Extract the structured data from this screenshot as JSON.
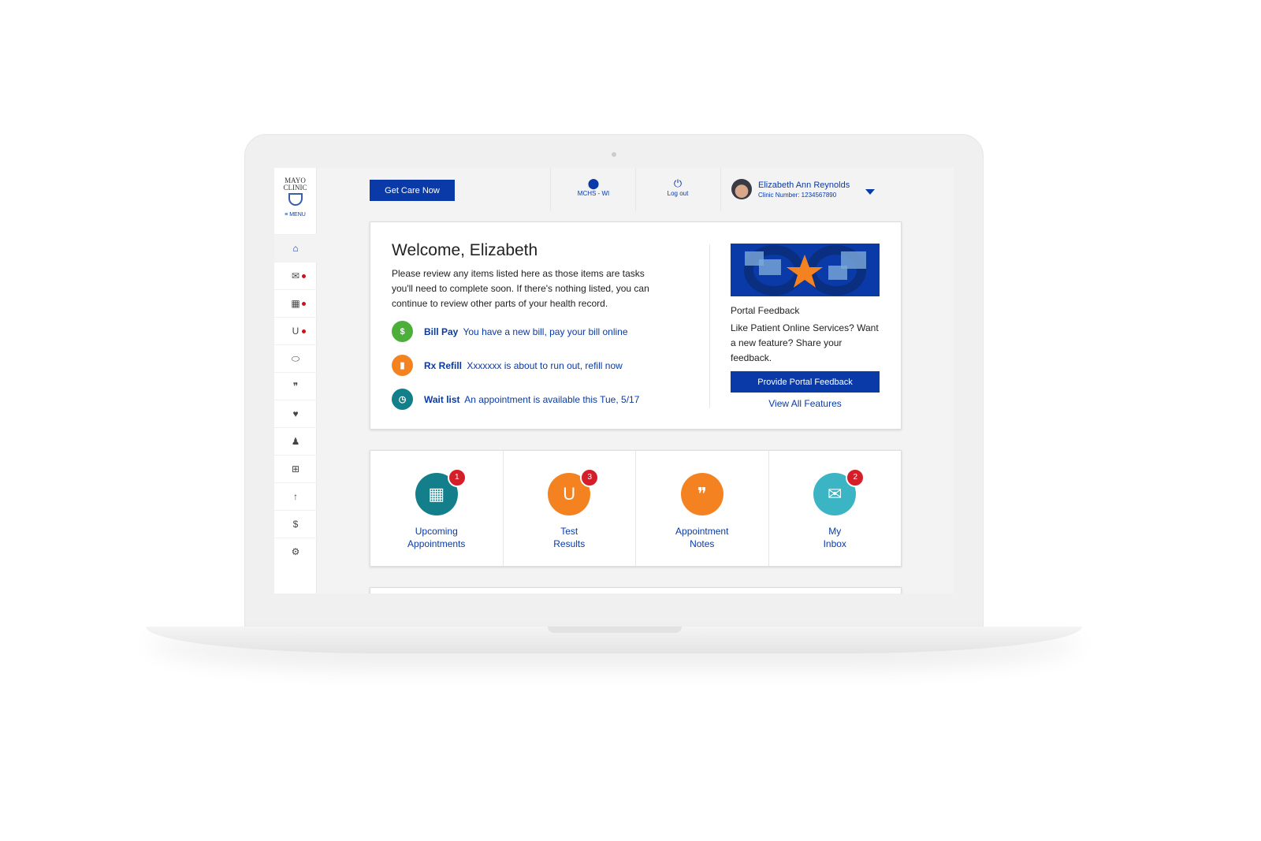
{
  "logo": {
    "text": "MAYO CLINIC",
    "menu": "≡ MENU"
  },
  "sidebar": {
    "items": [
      {
        "name": "home",
        "icon": "⌂",
        "dot": false,
        "active": true
      },
      {
        "name": "messages",
        "icon": "✉",
        "dot": true
      },
      {
        "name": "appointments",
        "icon": "▦",
        "dot": true
      },
      {
        "name": "test-results",
        "icon": "U",
        "dot": true
      },
      {
        "name": "medications",
        "icon": "⬭",
        "dot": false
      },
      {
        "name": "notes",
        "icon": "❞",
        "dot": false
      },
      {
        "name": "health-summary",
        "icon": "♥",
        "dot": false
      },
      {
        "name": "care-team",
        "icon": "♟",
        "dot": false
      },
      {
        "name": "records",
        "icon": "⊞",
        "dot": false
      },
      {
        "name": "documents",
        "icon": "↑",
        "dot": false
      },
      {
        "name": "billing",
        "icon": "$",
        "dot": false
      },
      {
        "name": "settings",
        "icon": "⚙",
        "dot": false
      }
    ]
  },
  "header": {
    "get_care": "Get Care Now",
    "location": "MCHS - WI",
    "logout": "Log out",
    "user_name": "Elizabeth Ann Reynolds",
    "clinic_number": "Clinic Number: 1234567890"
  },
  "welcome": {
    "title": "Welcome, Elizabeth",
    "intro": "Please review any items listed here as those items are tasks you'll need to complete soon. If there's nothing listed, you can continue to review other parts of your health record.",
    "tasks": [
      {
        "label": "Bill Pay",
        "text": "You have a new bill, pay your bill online",
        "color": "#4caf3a",
        "icon": "$"
      },
      {
        "label": "Rx Refill",
        "text": "Xxxxxxx is about to run out, refill now",
        "color": "#f58220",
        "icon": "▮"
      },
      {
        "label": "Wait list",
        "text": "An appointment is available this Tue, 5/17",
        "color": "#137f8a",
        "icon": "◷"
      }
    ]
  },
  "feedback": {
    "title": "Portal Feedback",
    "text": "Like Patient Online Services? Want a new feature?  Share your feedback.",
    "button": "Provide Portal Feedback",
    "link": "View All Features"
  },
  "tiles": [
    {
      "line1": "Upcoming",
      "line2": "Appointments",
      "badge": "1",
      "color": "#137f8a",
      "icon": "▦"
    },
    {
      "line1": "Test",
      "line2": "Results",
      "badge": "3",
      "color": "#f58220",
      "icon": "U"
    },
    {
      "line1": "Appointment",
      "line2": "Notes",
      "badge": "",
      "color": "#f58220",
      "icon": "❞"
    },
    {
      "line1": "My",
      "line2": "Inbox",
      "badge": "2",
      "color": "#3bb5c4",
      "icon": "✉"
    }
  ]
}
